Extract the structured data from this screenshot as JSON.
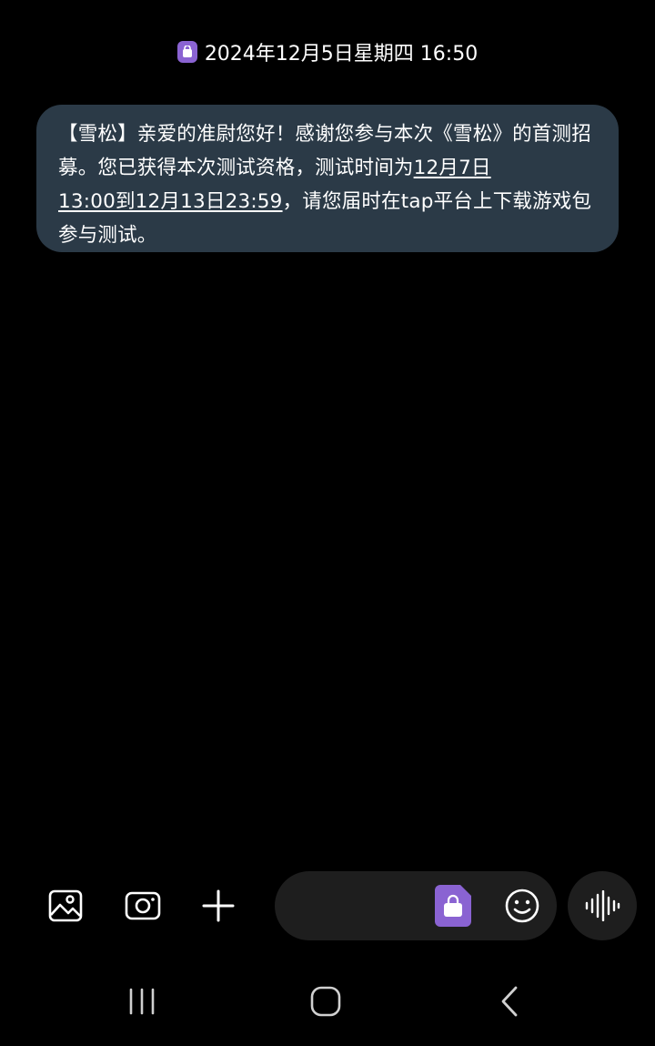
{
  "header": {
    "timestamp": "2024年12月5日星期四 16:50",
    "sim_badge_color": "#8a63d2"
  },
  "message": {
    "part1": "【雪松】亲爱的准尉您好！感谢您参与本次《雪松》的首测招募。您已获得本次测试资格，测试时间为",
    "link1": "12月7日",
    "link2": "13:00到12月13日23:59",
    "part2": "，请您届时在tap平台上下载游戏包参与测试。",
    "bubble_color": "#2b3a47"
  },
  "composer": {
    "input_value": "",
    "icons": [
      "gallery-icon",
      "camera-icon",
      "plus-icon",
      "sim-card-icon",
      "emoji-icon",
      "voice-icon"
    ]
  },
  "navbar": {
    "icons": [
      "recent-apps-icon",
      "home-icon",
      "back-icon"
    ]
  }
}
